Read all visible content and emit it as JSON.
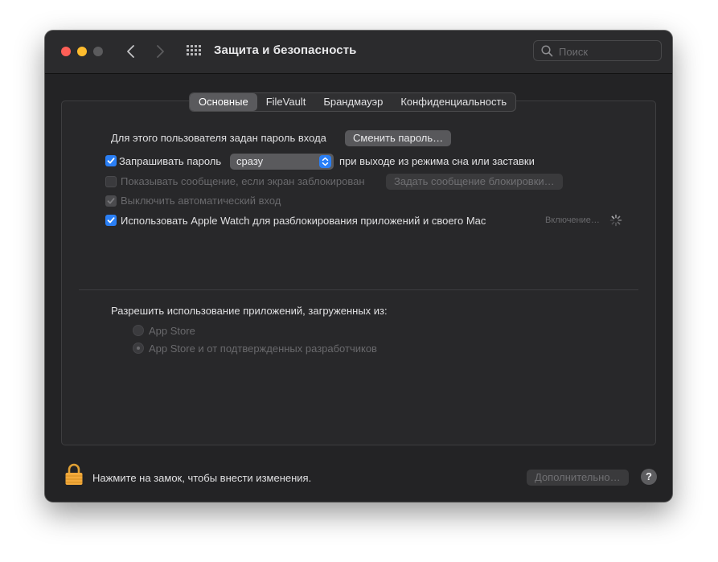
{
  "window": {
    "title": "Защита и безопасность",
    "search_placeholder": "Поиск"
  },
  "tabs": [
    {
      "label": "Основные",
      "active": true
    },
    {
      "label": "FileVault",
      "active": false
    },
    {
      "label": "Брандмауэр",
      "active": false
    },
    {
      "label": "Конфиденциальность",
      "active": false
    }
  ],
  "general": {
    "password_set_label": "Для этого пользователя задан пароль входа",
    "change_password_button": "Сменить пароль…",
    "require_password": {
      "checked": true,
      "label": "Запрашивать пароль",
      "select_value": "сразу",
      "suffix": "при выходе из режима сна или заставки"
    },
    "show_message": {
      "checked": false,
      "disabled": true,
      "label": "Показывать сообщение, если экран заблокирован",
      "button": "Задать сообщение блокировки…"
    },
    "disable_auto_login": {
      "checked": true,
      "disabled": true,
      "label": "Выключить автоматический вход"
    },
    "apple_watch": {
      "checked": true,
      "label": "Использовать Apple Watch для разблокирования приложений и своего Mac",
      "status": "Включение…"
    }
  },
  "downloads": {
    "heading": "Разрешить использование приложений, загруженных из:",
    "options": [
      {
        "label": "App Store",
        "selected": false
      },
      {
        "label": "App Store и от подтвержденных разработчиков",
        "selected": true
      }
    ]
  },
  "footer": {
    "lock_text": "Нажмите на замок, чтобы внести изменения.",
    "advanced_button": "Дополнительно…",
    "help_label": "?"
  },
  "colors": {
    "window_bg": "#232325",
    "accent": "#2a7ff5",
    "lock": "#f2a93b"
  }
}
